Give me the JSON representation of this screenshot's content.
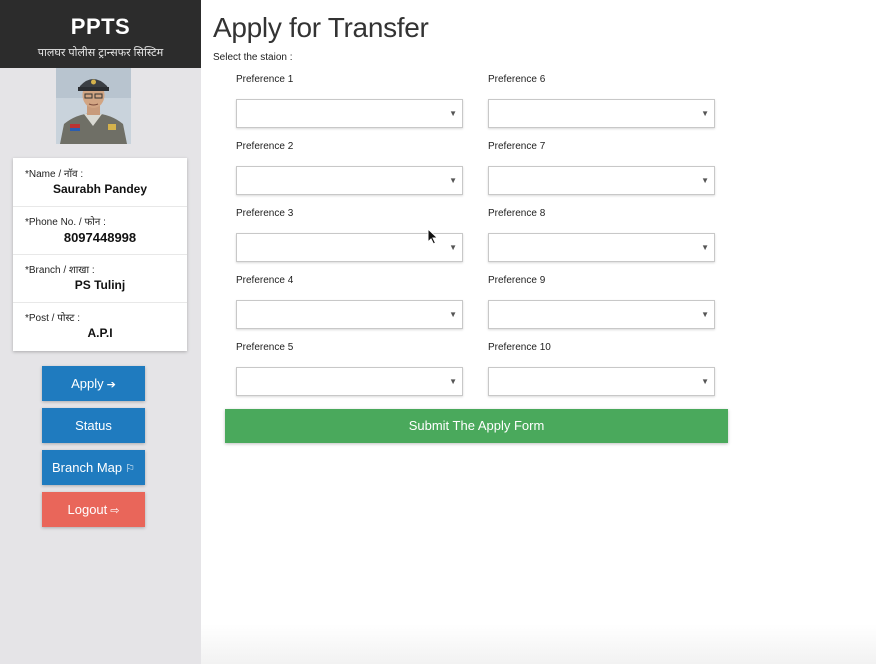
{
  "sidebar": {
    "brand_title": "PPTS",
    "brand_subtitle": "पालघर पोलीस ट्रान्सफर सिस्टिम",
    "profile": [
      {
        "label": "*Name / नाॅव :",
        "value": "Saurabh Pandey"
      },
      {
        "label": "*Phone No. / फोन :",
        "value": "8097448998"
      },
      {
        "label": "*Branch / शाखा :",
        "value": "PS Tulinj"
      },
      {
        "label": "*Post / पोस्ट :",
        "value": "A.P.I"
      }
    ],
    "nav": [
      {
        "label": "Apply",
        "icon": "arrow-right-icon",
        "glyph": "➔",
        "color": "#1f7bbf"
      },
      {
        "label": "Status",
        "icon": "",
        "glyph": "",
        "color": "#1f7bbf"
      },
      {
        "label": "Branch Map",
        "icon": "map-signs-icon",
        "glyph": "⚐",
        "color": "#1f7bbf"
      },
      {
        "label": "Logout",
        "icon": "sign-out-icon",
        "glyph": "⇨",
        "color": "#e9665a"
      }
    ]
  },
  "main": {
    "title": "Apply for Transfer",
    "select_label": "Select the staion :",
    "preferences": [
      {
        "label": "Preference 1",
        "value": ""
      },
      {
        "label": "Preference 2",
        "value": ""
      },
      {
        "label": "Preference 3",
        "value": ""
      },
      {
        "label": "Preference 4",
        "value": ""
      },
      {
        "label": "Preference 5",
        "value": ""
      },
      {
        "label": "Preference 6",
        "value": ""
      },
      {
        "label": "Preference 7",
        "value": ""
      },
      {
        "label": "Preference 8",
        "value": ""
      },
      {
        "label": "Preference 9",
        "value": ""
      },
      {
        "label": "Preference 10",
        "value": ""
      }
    ],
    "dropdown_caret": "▼",
    "submit_label": "Submit The Apply Form"
  },
  "colors": {
    "sidebar_bg": "#e5e4e7",
    "brand_bg": "#2c2c2c",
    "primary_blue": "#1f7bbf",
    "logout_red": "#e9665a",
    "submit_green": "#4aa95c"
  }
}
